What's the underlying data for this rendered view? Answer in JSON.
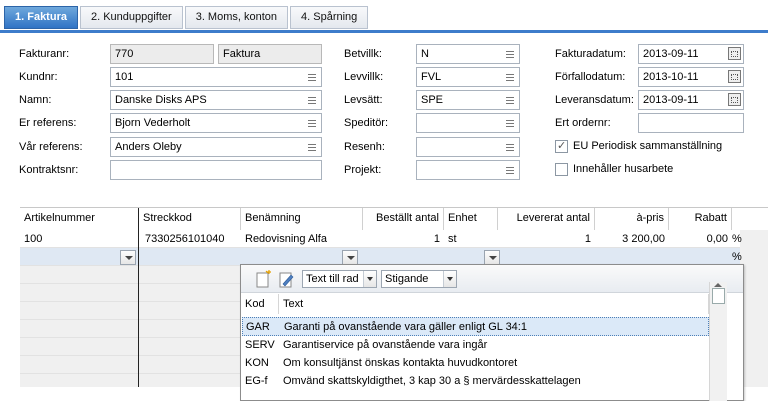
{
  "tabs": [
    "1. Faktura",
    "2. Kunduppgifter",
    "3. Moms, konton",
    "4. Spårning"
  ],
  "col1": {
    "fakturanr_label": "Fakturanr:",
    "fakturanr_value": "770",
    "fakturanr_type": "Faktura",
    "kundnr_label": "Kundnr:",
    "kundnr_value": "101",
    "namn_label": "Namn:",
    "namn_value": "Danske Disks APS",
    "er_referens_label": "Er referens:",
    "er_referens_value": "Bjorn Vederholt",
    "var_referens_label": "Vår referens:",
    "var_referens_value": "Anders Oleby",
    "kontraktsnr_label": "Kontraktsnr:",
    "kontraktsnr_value": ""
  },
  "col2": {
    "betvillk_label": "Betvillk:",
    "betvillk_value": "N",
    "levvillk_label": "Levvillk:",
    "levvillk_value": "FVL",
    "levsatt_label": "Levsätt:",
    "levsatt_value": "SPE",
    "speditor_label": "Speditör:",
    "speditor_value": "",
    "resenh_label": "Resenh:",
    "resenh_value": "",
    "projekt_label": "Projekt:",
    "projekt_value": ""
  },
  "col3": {
    "fakturadatum_label": "Fakturadatum:",
    "fakturadatum_value": "2013-09-11",
    "forfallodatum_label": "Förfallodatum:",
    "forfallodatum_value": "2013-10-11",
    "leveransdatum_label": "Leveransdatum:",
    "leveransdatum_value": "2013-09-11",
    "ert_ordernr_label": "Ert ordernr:",
    "ert_ordernr_value": "",
    "eu_label": "EU Periodisk sammanställning",
    "eu_checked": true,
    "husarbete_label": "Innehåller husarbete",
    "husarbete_checked": false
  },
  "grid": {
    "headers": [
      "Artikelnummer",
      "Streckkod",
      "Benämning",
      "Beställt antal",
      "Enhet",
      "Levererat antal",
      "à-pris",
      "Rabatt"
    ],
    "row1": [
      "100",
      "7330256101040",
      "Redovisning Alfa",
      "1",
      "st",
      "1",
      "3 200,00",
      "0,00",
      "%"
    ],
    "row2_suffix": "%"
  },
  "popup": {
    "text_mode": "Text till rad",
    "sort": "Stigande",
    "headers": [
      "Kod",
      "Text"
    ],
    "rows": [
      {
        "kod": "GAR",
        "text": "Garanti på ovanstående vara gäller enligt GL 34:1"
      },
      {
        "kod": "SERV",
        "text": "Garantiservice på ovanstående vara ingår"
      },
      {
        "kod": "KON",
        "text": "Om konsultjänst önskas kontakta huvudkontoret"
      },
      {
        "kod": "EG-f",
        "text": "Omvänd skattskyldigthet, 3 kap 30 a § mervärdesskattelagen"
      }
    ]
  }
}
